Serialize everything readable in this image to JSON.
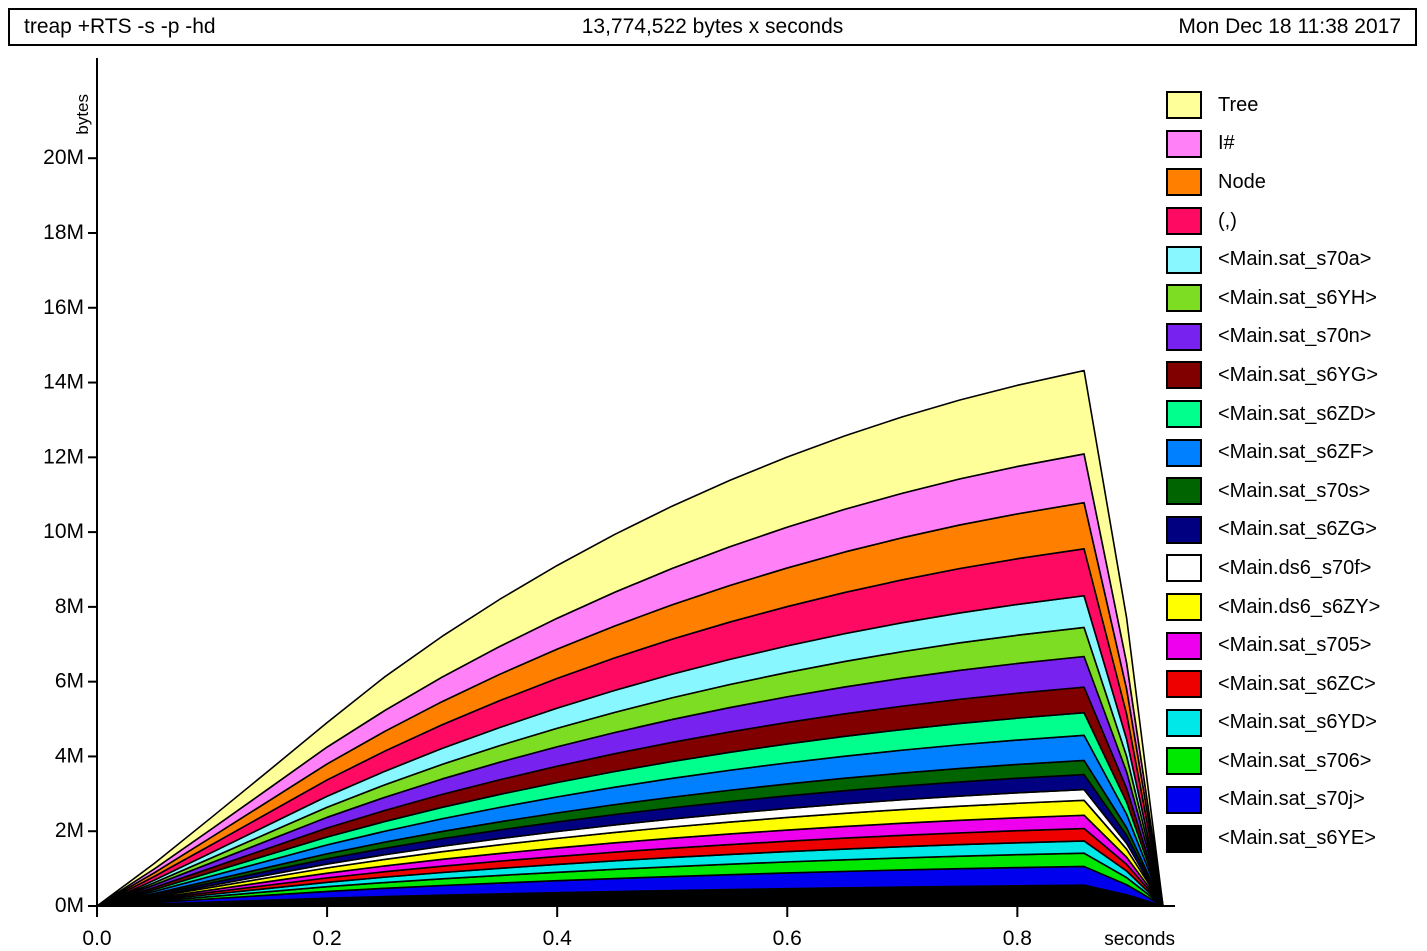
{
  "header": {
    "job": "treap +RTS -s -p -hd",
    "total": "13,774,522 bytes x seconds",
    "date": "Mon Dec 18 11:38 2017"
  },
  "axes": {
    "y_title": "bytes",
    "x_title": "seconds",
    "y_ticks": [
      "0M",
      "2M",
      "4M",
      "6M",
      "8M",
      "10M",
      "12M",
      "14M",
      "16M",
      "18M",
      "20M"
    ],
    "x_ticks": [
      "0.0",
      "0.2",
      "0.4",
      "0.6",
      "0.8"
    ]
  },
  "chart_data": {
    "type": "area",
    "title": "13,774,522 bytes x seconds",
    "subtitle": "treap +RTS -s -p -hd",
    "xlabel": "seconds",
    "ylabel": "bytes",
    "xlim": [
      0.0,
      0.9266
    ],
    "ylim": [
      0,
      22600000
    ],
    "ytick_values": [
      0,
      2000000,
      4000000,
      6000000,
      8000000,
      10000000,
      12000000,
      14000000,
      16000000,
      18000000,
      20000000
    ],
    "ytick_labels": [
      "0M",
      "2M",
      "4M",
      "6M",
      "8M",
      "10M",
      "12M",
      "14M",
      "16M",
      "18M",
      "20M"
    ],
    "xtick_values": [
      0.0,
      0.2,
      0.4,
      0.6,
      0.8
    ],
    "xtick_labels": [
      "0.0",
      "0.2",
      "0.4",
      "0.6",
      "0.8"
    ],
    "grid": false,
    "legend_position": "right",
    "stacked": true,
    "stack_order": "top_is_last_series",
    "x": [
      0.0,
      0.05,
      0.1,
      0.15,
      0.2,
      0.25,
      0.3,
      0.35,
      0.4,
      0.45,
      0.5,
      0.55,
      0.6,
      0.65,
      0.7,
      0.75,
      0.8,
      0.858,
      0.895,
      0.9266
    ],
    "series": [
      {
        "name": "<Main.sat_s6YE>",
        "color": "#000000",
        "values": [
          0,
          52000,
          104000,
          156000,
          208000,
          252000,
          290000,
          324000,
          356000,
          386000,
          414000,
          440000,
          464000,
          486000,
          506000,
          524000,
          540000,
          556000,
          300000,
          0
        ]
      },
      {
        "name": "<Main.sat_s70j>",
        "color": "#0000ee",
        "values": [
          0,
          44000,
          90000,
          136000,
          182000,
          222000,
          258000,
          290000,
          320000,
          348000,
          374000,
          398000,
          420000,
          440000,
          458000,
          474000,
          488000,
          502000,
          270000,
          0
        ]
      },
      {
        "name": "<Main.sat_s706>",
        "color": "#00e800",
        "values": [
          0,
          30000,
          62000,
          94000,
          126000,
          154000,
          180000,
          204000,
          226000,
          246000,
          264000,
          280000,
          296000,
          310000,
          322000,
          334000,
          344000,
          354000,
          190000,
          0
        ]
      },
      {
        "name": "<Main.sat_s6YD>",
        "color": "#00e8e8",
        "values": [
          0,
          28000,
          58000,
          88000,
          118000,
          144000,
          168000,
          190000,
          210000,
          229000,
          246000,
          261000,
          275000,
          288000,
          300000,
          310000,
          319000,
          328000,
          176000,
          0
        ]
      },
      {
        "name": "<Main.sat_s6ZC>",
        "color": "#ee0000",
        "values": [
          0,
          28000,
          58000,
          88000,
          118000,
          145000,
          170000,
          192000,
          213000,
          232000,
          249000,
          265000,
          279000,
          292000,
          304000,
          314000,
          323000,
          332000,
          178000,
          0
        ]
      },
      {
        "name": "<Main.sat_s705>",
        "color": "#ee00ee",
        "values": [
          0,
          30000,
          62000,
          94000,
          126000,
          155000,
          182000,
          206000,
          228000,
          248000,
          266000,
          283000,
          298000,
          312000,
          324000,
          335000,
          345000,
          355000,
          190000,
          0
        ]
      },
      {
        "name": "<Main.ds6_s6ZY>",
        "color": "#ffff00",
        "values": [
          0,
          34000,
          70000,
          106000,
          142000,
          174000,
          204000,
          231000,
          256000,
          279000,
          300000,
          319000,
          336000,
          352000,
          366000,
          378000,
          389000,
          400000,
          215000,
          0
        ]
      },
      {
        "name": "<Main.ds6_s70f>",
        "color": "#ffffff",
        "values": [
          0,
          24000,
          50000,
          76000,
          102000,
          125000,
          146000,
          166000,
          184000,
          200000,
          215000,
          229000,
          241000,
          252000,
          262000,
          271000,
          279000,
          287000,
          154000,
          0
        ]
      },
      {
        "name": "<Main.sat_s6ZG>",
        "color": "#000080",
        "values": [
          0,
          34000,
          70000,
          106000,
          142000,
          174000,
          204000,
          231000,
          256000,
          279000,
          300000,
          319000,
          337000,
          353000,
          367000,
          380000,
          391000,
          402000,
          216000,
          0
        ]
      },
      {
        "name": "<Main.sat_s70s>",
        "color": "#006400",
        "values": [
          0,
          32000,
          66000,
          100000,
          134000,
          164000,
          192000,
          218000,
          242000,
          264000,
          284000,
          302000,
          318000,
          333000,
          346000,
          358000,
          368000,
          378000,
          203000,
          0
        ]
      },
      {
        "name": "<Main.sat_s6ZF>",
        "color": "#0080ff",
        "values": [
          0,
          56000,
          116000,
          176000,
          236000,
          290000,
          340000,
          386000,
          428000,
          467000,
          503000,
          535000,
          564000,
          590000,
          614000,
          635000,
          653000,
          672000,
          361000,
          0
        ]
      },
      {
        "name": "<Main.sat_s6ZD>",
        "color": "#00ff8c",
        "values": [
          0,
          50000,
          104000,
          158000,
          212000,
          260000,
          305000,
          346000,
          384000,
          419000,
          451000,
          480000,
          506000,
          530000,
          551000,
          570000,
          586000,
          603000,
          324000,
          0
        ]
      },
      {
        "name": "<Main.sat_s6YG>",
        "color": "#800000",
        "values": [
          0,
          56000,
          116000,
          178000,
          240000,
          295000,
          346000,
          393000,
          436000,
          476000,
          512000,
          545000,
          575000,
          602000,
          626000,
          647000,
          666000,
          685000,
          368000,
          0
        ]
      },
      {
        "name": "<Main.sat_s70n>",
        "color": "#7722ee",
        "values": [
          0,
          66000,
          138000,
          212000,
          286000,
          352000,
          413000,
          469000,
          521000,
          568000,
          612000,
          651000,
          687000,
          719000,
          748000,
          774000,
          796000,
          819000,
          440000,
          0
        ]
      },
      {
        "name": "<Main.sat_s6YH>",
        "color": "#7ddd22",
        "values": [
          0,
          62000,
          130000,
          200000,
          270000,
          333000,
          391000,
          444000,
          493000,
          538000,
          579000,
          617000,
          651000,
          682000,
          709000,
          734000,
          755000,
          777000,
          418000,
          0
        ]
      },
      {
        "name": "<Main.sat_s70a>",
        "color": "#88f7ff",
        "values": [
          0,
          68000,
          142000,
          218000,
          294000,
          363000,
          426000,
          484000,
          538000,
          587000,
          632000,
          673000,
          710000,
          744000,
          774000,
          801000,
          824000,
          848000,
          456000,
          0
        ]
      },
      {
        "name": "(,)",
        "color": "#ff0a63",
        "values": [
          0,
          100000,
          210000,
          322000,
          436000,
          538000,
          632000,
          718000,
          797000,
          870000,
          937000,
          997000,
          1052000,
          1102000,
          1147000,
          1187000,
          1222000,
          1256000,
          675000,
          0
        ]
      },
      {
        "name": "Node",
        "color": "#ff8000",
        "values": [
          0,
          98000,
          206000,
          316000,
          428000,
          528000,
          620000,
          705000,
          783000,
          854000,
          920000,
          979000,
          1033000,
          1082000,
          1126000,
          1166000,
          1200000,
          1234000,
          664000,
          0
        ]
      },
      {
        "name": "I#",
        "color": "#ff80f7",
        "values": [
          0,
          104000,
          218000,
          334000,
          452000,
          558000,
          655000,
          744000,
          826000,
          902000,
          971000,
          1034000,
          1091000,
          1143000,
          1190000,
          1231000,
          1268000,
          1303000,
          701000,
          0
        ]
      },
      {
        "name": "Tree",
        "color": "#ffff99",
        "values": [
          0,
          148000,
          312000,
          480000,
          652000,
          900000,
          1090000,
          1260000,
          1410000,
          1545000,
          1667000,
          1777000,
          1875000,
          1963000,
          2042000,
          2111000,
          2170000,
          2230000,
          1199000,
          0
        ]
      }
    ]
  },
  "legend": {
    "items": [
      {
        "label": "Tree",
        "color": "#ffff99"
      },
      {
        "label": "I#",
        "color": "#ff80f7"
      },
      {
        "label": "Node",
        "color": "#ff8000"
      },
      {
        "label": "(,)",
        "color": "#ff0a63"
      },
      {
        "label": "<Main.sat_s70a>",
        "color": "#88f7ff"
      },
      {
        "label": "<Main.sat_s6YH>",
        "color": "#7ddd22"
      },
      {
        "label": "<Main.sat_s70n>",
        "color": "#7722ee"
      },
      {
        "label": "<Main.sat_s6YG>",
        "color": "#800000"
      },
      {
        "label": "<Main.sat_s6ZD>",
        "color": "#00ff8c"
      },
      {
        "label": "<Main.sat_s6ZF>",
        "color": "#0080ff"
      },
      {
        "label": "<Main.sat_s70s>",
        "color": "#006400"
      },
      {
        "label": "<Main.sat_s6ZG>",
        "color": "#000080"
      },
      {
        "label": "<Main.ds6_s70f>",
        "color": "#ffffff"
      },
      {
        "label": "<Main.ds6_s6ZY>",
        "color": "#ffff00"
      },
      {
        "label": "<Main.sat_s705>",
        "color": "#ee00ee"
      },
      {
        "label": "<Main.sat_s6ZC>",
        "color": "#ee0000"
      },
      {
        "label": "<Main.sat_s6YD>",
        "color": "#00e8e8"
      },
      {
        "label": "<Main.sat_s706>",
        "color": "#00e800"
      },
      {
        "label": "<Main.sat_s70j>",
        "color": "#0000ee"
      },
      {
        "label": "<Main.sat_s6YE>",
        "color": "#000000"
      }
    ]
  }
}
